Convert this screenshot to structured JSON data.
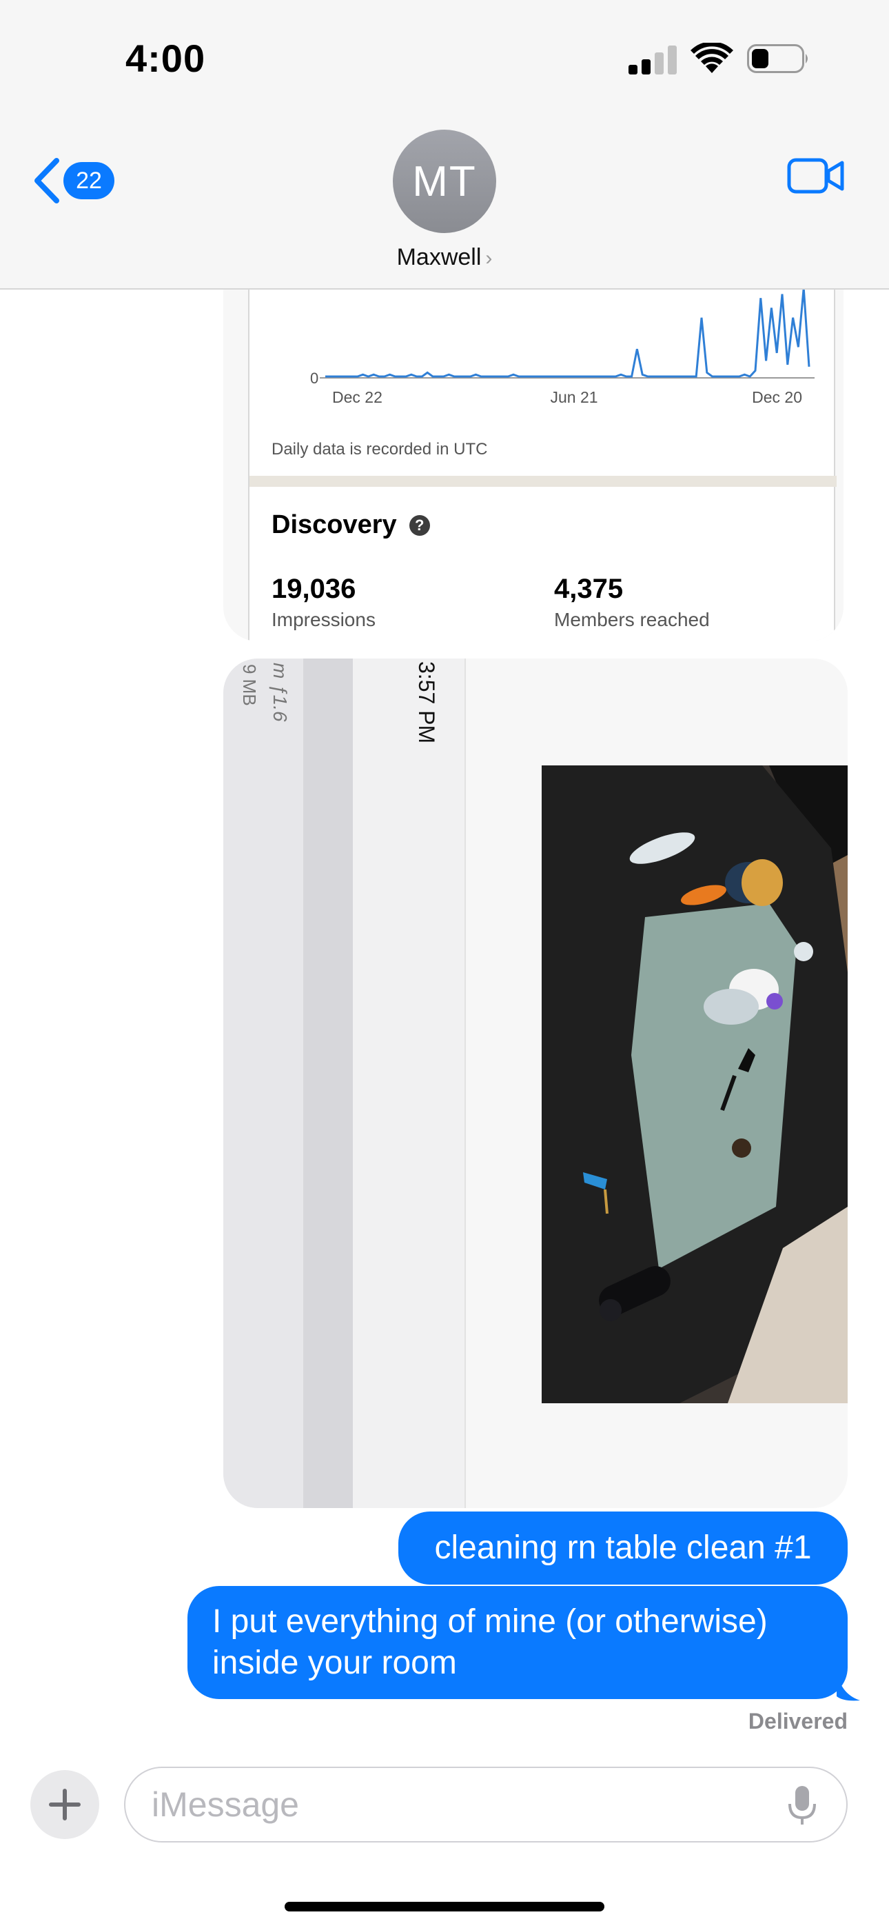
{
  "status_bar": {
    "time": "4:00"
  },
  "header": {
    "back_count": "22",
    "avatar_initials": "MT",
    "contact_name": "Maxwell",
    "contact_chevron": "›",
    "icons": {
      "back": "chevron-left-icon",
      "video": "video-camera-icon"
    },
    "accent_color": "#0a7aff"
  },
  "chart_shot": {
    "chart_data": {
      "type": "line",
      "y_tick": "0",
      "x_ticks": [
        "Dec 22",
        "Jun 21",
        "Dec 20"
      ],
      "series": [
        {
          "values": [
            0,
            0,
            0,
            0,
            0,
            0,
            0,
            1,
            0,
            1,
            0,
            0,
            1,
            0,
            0,
            0,
            1,
            0,
            0,
            2,
            0,
            0,
            0,
            1,
            0,
            0,
            0,
            0,
            1,
            0,
            0,
            0,
            0,
            0,
            0,
            1,
            0,
            0,
            0,
            0,
            0,
            0,
            0,
            0,
            0,
            0,
            0,
            0,
            0,
            0,
            0,
            0,
            0,
            0,
            0,
            1,
            0,
            0,
            14,
            1,
            0,
            0,
            0,
            0,
            0,
            0,
            0,
            0,
            0,
            0,
            30,
            2,
            0,
            0,
            0,
            0,
            0,
            0,
            1,
            0,
            3,
            40,
            8,
            35,
            12,
            42,
            6,
            30,
            15,
            45,
            5
          ]
        }
      ],
      "color": "#2f7fd6"
    },
    "note": "Daily data is recorded in UTC",
    "section_title": "Discovery",
    "help_icon": "?",
    "metrics": [
      {
        "value": "19,036",
        "label": "Impressions"
      },
      {
        "value": "4,375",
        "label": "Members reached"
      }
    ]
  },
  "photo_message": {
    "meta_aperture": "m ƒ1.6",
    "meta_size": "9 MB",
    "time": "3:57 PM"
  },
  "sent_messages": [
    "cleaning rn table clean #1",
    "I put everything of mine (or otherwise) inside your room"
  ],
  "delivered_label": "Delivered",
  "composer": {
    "placeholder": "iMessage",
    "icons": {
      "plus": "plus-icon",
      "mic": "microphone-icon"
    }
  }
}
